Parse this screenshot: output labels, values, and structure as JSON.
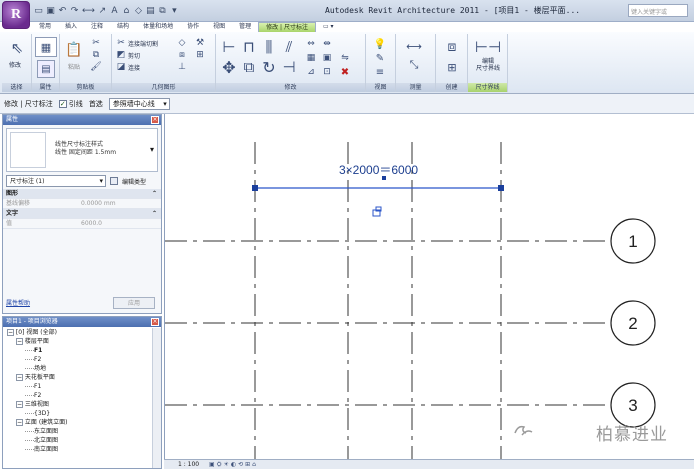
{
  "window": {
    "app_button": "R",
    "title": "Autodesk Revit Architecture 2011 - [项目1 - 楼层平面...",
    "search_placeholder": "键入关键字或"
  },
  "ribbon_tabs": [
    {
      "label": "常用",
      "active": false
    },
    {
      "label": "插入",
      "active": false
    },
    {
      "label": "注释",
      "active": false
    },
    {
      "label": "结构",
      "active": false
    },
    {
      "label": "体量和场地",
      "active": false
    },
    {
      "label": "协作",
      "active": false
    },
    {
      "label": "视图",
      "active": false
    },
    {
      "label": "管理",
      "active": false
    },
    {
      "label": "修改 | 尺寸标注",
      "active": true
    },
    {
      "label": "▭ ▾",
      "active": false
    }
  ],
  "ribbon_panels": {
    "select": "选择",
    "properties": "属性",
    "clipboard": "剪贴板",
    "geometry": "几何图形",
    "modify": "修改",
    "view": "视图",
    "measure": "测量",
    "create": "创建",
    "dimension_witness": "尺寸界线"
  },
  "ribbon_buttons": {
    "modify": "修改",
    "paste": "粘贴",
    "connect_end_cut": "连接端切割",
    "cut": "剪切",
    "join": "连接",
    "edit_witness_lines": "编辑\n尺寸界线"
  },
  "options_bar": {
    "context": "修改 | 尺寸标注",
    "lead_checkbox_label": "引线",
    "lead_checked": true,
    "preference_label": "首选",
    "preference_value": "参照墙中心线"
  },
  "properties": {
    "title": "属性",
    "type_name_line1": "线性尺寸标注样式",
    "type_name_line2": "线性 固定间距 1.5mm",
    "instance_filter": "尺寸标注 (1)",
    "edit_type": "编辑类型",
    "groups": [
      {
        "name": "图形",
        "rows": [
          {
            "label": "基线偏移",
            "value": "0.0000 mm"
          }
        ]
      },
      {
        "name": "文字",
        "rows": [
          {
            "label": "值",
            "value": "6000.0"
          }
        ]
      }
    ],
    "help_link": "属性帮助",
    "apply": "应用"
  },
  "project_browser": {
    "title": "项目1 - 项目浏览器",
    "nodes": [
      {
        "level": 0,
        "exp": "−",
        "text": "[0] 视图 (全部)",
        "bold": false
      },
      {
        "level": 1,
        "exp": "−",
        "text": "楼层平面",
        "bold": false
      },
      {
        "level": 2,
        "exp": "",
        "text": "F1",
        "bold": true
      },
      {
        "level": 2,
        "exp": "",
        "text": "F2",
        "bold": false
      },
      {
        "level": 2,
        "exp": "",
        "text": "场地",
        "bold": false
      },
      {
        "level": 1,
        "exp": "−",
        "text": "天花板平面",
        "bold": false
      },
      {
        "level": 2,
        "exp": "",
        "text": "F1",
        "bold": false
      },
      {
        "level": 2,
        "exp": "",
        "text": "F2",
        "bold": false
      },
      {
        "level": 1,
        "exp": "−",
        "text": "三维视图",
        "bold": false
      },
      {
        "level": 2,
        "exp": "",
        "text": "{3D}",
        "bold": false
      },
      {
        "level": 1,
        "exp": "−",
        "text": "立面 (建筑立面)",
        "bold": false
      },
      {
        "level": 2,
        "exp": "",
        "text": "东立面图",
        "bold": false
      },
      {
        "level": 2,
        "exp": "",
        "text": "北立面图",
        "bold": false
      },
      {
        "level": 2,
        "exp": "",
        "text": "南立面图",
        "bold": false
      }
    ]
  },
  "drawing": {
    "dimension_text": "3×2000＝6000",
    "grid_labels": [
      "1",
      "2",
      "3"
    ]
  },
  "status": {
    "scale": "1 : 100"
  },
  "watermark": "柏慕进业",
  "colors": {
    "dimension": "#1d3f8f",
    "grid_line": "#333333",
    "contextual_tab": "#a9d46a",
    "palette_header": "#4c6fb0"
  }
}
